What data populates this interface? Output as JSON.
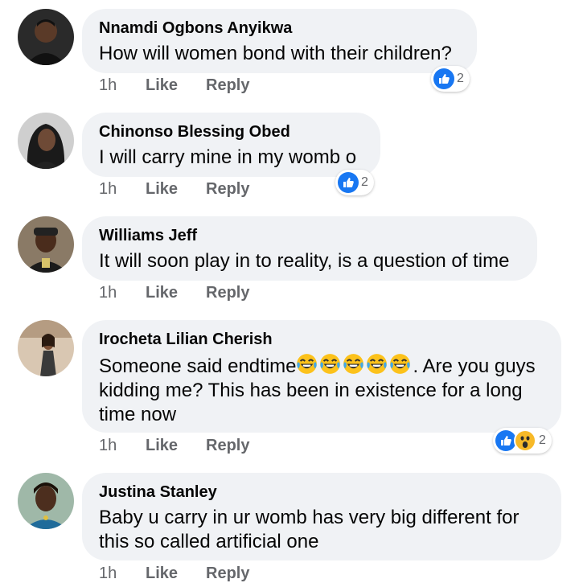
{
  "colors": {
    "bubble_bg": "#f0f2f5",
    "like_blue": "#1877f2",
    "wow_yellow": "#f7b928",
    "meta_gray": "#65676b"
  },
  "comments": [
    {
      "author": "Nnamdi Ogbons Anyikwa",
      "text": "How will women bond with their children?",
      "time": "1h",
      "like_label": "Like",
      "reply_label": "Reply",
      "reactions": [
        "like-icon"
      ],
      "reaction_count": "2"
    },
    {
      "author": "Chinonso Blessing Obed",
      "text": "I will carry mine in my womb o",
      "time": "1h",
      "like_label": "Like",
      "reply_label": "Reply",
      "reactions": [
        "like-icon"
      ],
      "reaction_count": "2"
    },
    {
      "author": "Williams Jeff",
      "text": "It will soon play in to reality, is a question of time",
      "time": "1h",
      "like_label": "Like",
      "reply_label": "Reply"
    },
    {
      "author": "Irocheta Lilian Cherish",
      "text_line1_start": "Someone said endtime",
      "emoji": "laughing-crying-emoji",
      "emoji_count": 5,
      "text_line1_end": ". Are you guys",
      "text_line2": "kidding me? This has been in existence for a long",
      "text_line3": "time now",
      "time": "1h",
      "like_label": "Like",
      "reply_label": "Reply",
      "reactions": [
        "like-icon",
        "wow-icon"
      ],
      "reaction_count": "2"
    },
    {
      "author": "Justina Stanley",
      "text_line1": "Baby u carry in ur womb has very big different for",
      "text_line2": "this so called  artificial one",
      "time": "1h",
      "like_label": "Like",
      "reply_label": "Reply"
    }
  ]
}
